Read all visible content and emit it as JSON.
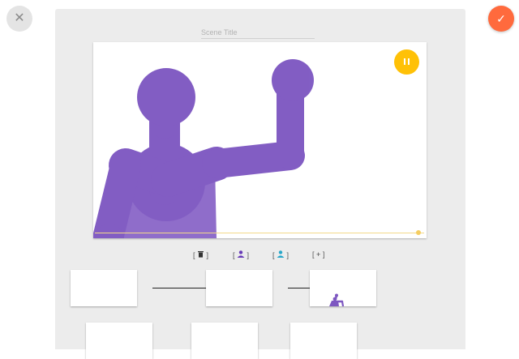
{
  "window": {
    "close_glyph": "✕",
    "confirm_glyph": "✓"
  },
  "scene": {
    "title_value": "",
    "title_placeholder": "Scene Title",
    "figure_color": "#673ab7",
    "playback": {
      "state": "playing",
      "progress": 1.0
    }
  },
  "toolbar": {
    "items": [
      {
        "name": "delete-frame",
        "icon": "trash-icon",
        "color": "#333333"
      },
      {
        "name": "add-purple-figure",
        "icon": "person-icon",
        "color": "#673ab7"
      },
      {
        "name": "add-teal-figure",
        "icon": "person-icon",
        "color": "#26a6c9"
      },
      {
        "name": "add-frame",
        "icon": "plus-icon",
        "color": "#333333",
        "glyph": "+"
      }
    ]
  },
  "frames": {
    "rows": [
      {
        "count": 3
      },
      {
        "count": 3
      }
    ]
  },
  "colors": {
    "accent": "#ff6a3d",
    "play": "#ffc107",
    "figure": "#673ab7",
    "teal": "#26a6c9"
  }
}
